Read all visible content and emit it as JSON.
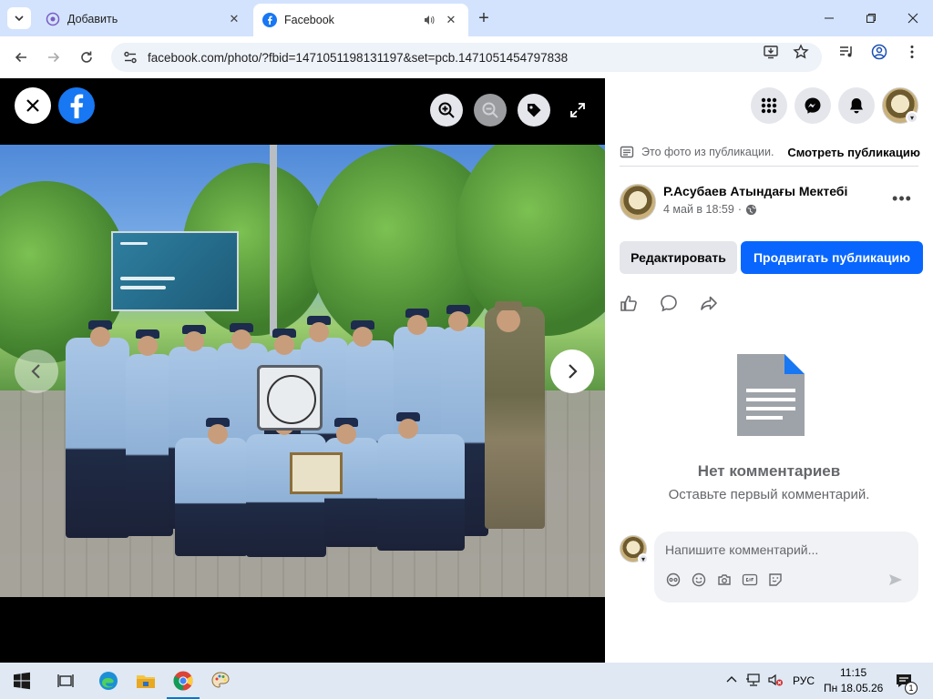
{
  "browser": {
    "tabs": [
      {
        "title": "Добавить",
        "active": false
      },
      {
        "title": "Facebook",
        "active": true,
        "audio": true
      }
    ],
    "url": "facebook.com/photo/?fbid=1471051198131197&set=pcb.1471051454797838"
  },
  "viewer": {
    "close_icon": "close-icon",
    "tools": [
      "zoom-in-icon",
      "zoom-out-icon",
      "tag-icon",
      "fullscreen-icon"
    ]
  },
  "panel": {
    "post_note": "Это фото из публикации.",
    "see_post": "Смотреть публикацию",
    "author": "Р.Асубаев Атындағы Мектебі",
    "date": "4 май в 18:59",
    "edit_label": "Редактировать",
    "promote_label": "Продвигать публикацию",
    "empty_title": "Нет комментариев",
    "empty_subtitle": "Оставьте первый комментарий.",
    "comment_placeholder": "Напишите комментарий..."
  },
  "taskbar": {
    "lang": "РУС",
    "time": "11:15",
    "date": "Пн 18.05.26",
    "notif_count": "1"
  },
  "colors": {
    "fb_blue": "#1877f2",
    "promote_blue": "#0866ff",
    "tabbar": "#d3e3fd"
  }
}
